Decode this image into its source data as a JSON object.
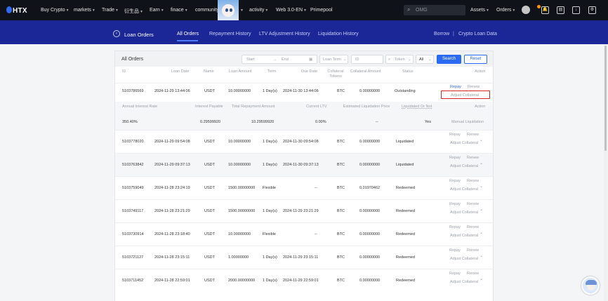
{
  "topnav": {
    "logo": "HTX",
    "items": [
      "Buy Crypto",
      "markets",
      "Trade",
      "衍生品",
      "Earn",
      "finace",
      "community",
      "activity",
      "Web 3.0-EN",
      "Primepool"
    ],
    "search_placeholder": "OMG",
    "assets": "Assets",
    "orders": "Orders"
  },
  "subnav": {
    "title": "Loan Orders",
    "tabs": [
      "All Orders",
      "Repayment History",
      "LTV Adjustment History",
      "Liquidation History"
    ],
    "borrow": "Borrow",
    "sep": "|",
    "crypto_loan_data": "Crypto Loan Data"
  },
  "panel": {
    "title": "All Orders",
    "filters": {
      "start": "Start",
      "arrow": "→",
      "end": "End",
      "loan_term": "Loan Term",
      "id": "ID",
      "token": "Token",
      "all": "All",
      "search": "Search",
      "reset": "Reset"
    },
    "headers": [
      "ID",
      "Loan Date",
      "Name",
      "Loan Amount",
      "Term",
      "Due Date",
      "Collateral Tokens",
      "Collateral Amount",
      "Status",
      "Action"
    ],
    "expanded_headers": [
      "Annual Interest Rate",
      "Interest Payable",
      "Total Repayment Amount",
      "Current LTV",
      "Estimated Liquidation Price",
      "Liquidated Or Not",
      "Action"
    ],
    "expanded_values": [
      "350.40%",
      "0.29599920",
      "10.29599920",
      "0.00%",
      "--",
      "Yes",
      "Manual Liquidation"
    ],
    "actions": {
      "repay": "Repay",
      "renew": "Renew",
      "adjust": "Adjust Collateral"
    },
    "rows": [
      {
        "id": "5103786569",
        "date": "2024-11-29 13:44:06",
        "name": "USDT",
        "amount": "10.00000000",
        "term": "1 Day(s)",
        "due": "2024-11-30 13:44:06",
        "ctoken": "BTC",
        "camount": "0.00000000",
        "status": "Outstanding"
      },
      {
        "id": "5103778020",
        "date": "2024-11-29 09:54:08",
        "name": "USDT",
        "amount": "10.00000000",
        "term": "1 Day(s)",
        "due": "2024-11-30 09:54:08",
        "ctoken": "BTC",
        "camount": "0.00000000",
        "status": "Liquidated"
      },
      {
        "id": "5103763842",
        "date": "2024-11-29 09:37:13",
        "name": "USDT",
        "amount": "10.00000000",
        "term": "1 Day(s)",
        "due": "2024-11-30 09:37:13",
        "ctoken": "BTC",
        "camount": "0.00000000",
        "status": "Liquidated"
      },
      {
        "id": "5103759049",
        "date": "2024-11-28 23:24:19",
        "name": "USDT",
        "amount": "1500.00000000",
        "term": "Flexible",
        "due": "--",
        "ctoken": "BTC",
        "camount": "0.01970462",
        "status": "Redeemed"
      },
      {
        "id": "5103749117",
        "date": "2024-11-28 23:21:29",
        "name": "USDT",
        "amount": "1500.00000000",
        "term": "1 Day(s)",
        "due": "2024-11-29 23:21:29",
        "ctoken": "BTC",
        "camount": "0.00000000",
        "status": "Redeemed"
      },
      {
        "id": "5103730914",
        "date": "2024-11-28 23:18:40",
        "name": "USDT",
        "amount": "10.00000000",
        "term": "Flexible",
        "due": "--",
        "ctoken": "BTC",
        "camount": "0.00000000",
        "status": "Redeemed"
      },
      {
        "id": "5103721127",
        "date": "2024-11-28 23:15:11",
        "name": "USDT",
        "amount": "1.00000000",
        "term": "1 Day(s)",
        "due": "2024-11-29 23:15:11",
        "ctoken": "BTC",
        "camount": "0.00000000",
        "status": "Redeemed"
      },
      {
        "id": "5103711452",
        "date": "2024-11-28 22:59:01",
        "name": "USDT",
        "amount": "2000.00000000",
        "term": "1 Day(s)",
        "due": "2024-11-29 22:59:01",
        "ctoken": "BTC",
        "camount": "0.00000000",
        "status": "Redeemed"
      }
    ]
  },
  "colors": {
    "nav_bg": "#0f1218",
    "subnav_bg": "#1b2796",
    "accent": "#2b6bf3",
    "highlight": "#e02424"
  }
}
